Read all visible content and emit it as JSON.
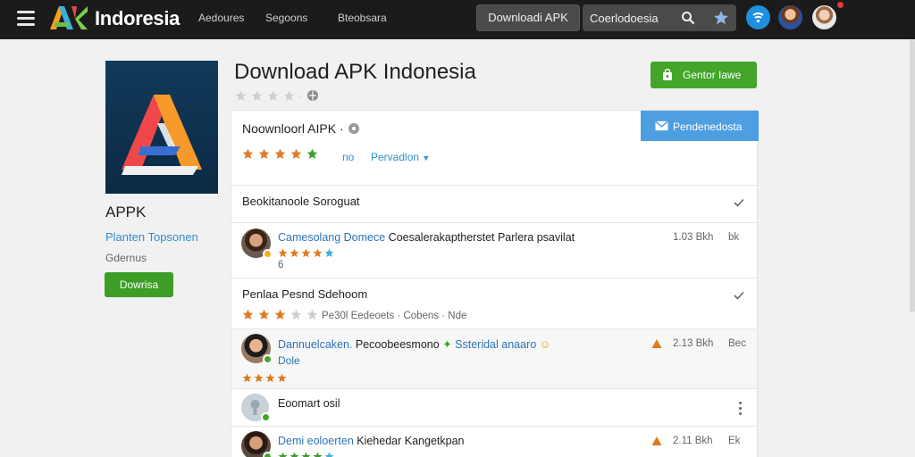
{
  "header": {
    "logo_text": "Indoresia",
    "nav": [
      "Aedoures",
      "Segoons",
      "Bteobsara"
    ],
    "download_button": "Downloadi APK",
    "search_value": "Coerlodoesia"
  },
  "sidebar": {
    "app_name": "APPK",
    "developer": "Planten Topsonen",
    "category": "Gdernus",
    "button": "Dowrisa"
  },
  "page": {
    "title": "Download APK Indonesia",
    "primary_button": "Gentor Iawe"
  },
  "card": {
    "title": "Noownloorl AIPK",
    "rating_count": "no",
    "link": "Pervadlon",
    "blue_button": "Pendenedosta"
  },
  "sections": [
    {
      "title": "Beokitanoole Soroguat"
    },
    {
      "title": "Penlaa Pesnd Sdehoom",
      "meta": "Pe30l Eedeoets · Cobens · Nde"
    },
    {
      "title": "Eoomart osil"
    }
  ],
  "reviews": [
    {
      "name": "Camesolang Domece",
      "text": " Coesalerakaptherstet Parlera psavilat",
      "size": "1.03 Bkh",
      "unit": "bk",
      "extra": "6"
    },
    {
      "name": "Dannuelcaken.",
      "text": " Pecoobeesmono",
      "text2": "Ssteridal anaaro",
      "size": "2.13 Bkh",
      "unit": "Bec",
      "extra": "Dole"
    },
    {
      "name": "Demi eoloerten",
      "text": " Kiehedar Kangetkpan",
      "size": "2.11 Bkh",
      "unit": "Ek"
    }
  ],
  "colors": {
    "topbar": "#1b1b1b",
    "accent_green": "#43a52a",
    "accent_blue": "#4e9ee2",
    "link_blue": "#2e8fcf",
    "star_orange": "#e07a1f"
  }
}
